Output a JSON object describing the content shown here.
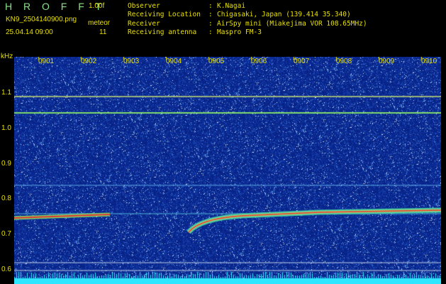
{
  "header": {
    "app_title": "H R O F F T",
    "version": "1.00f",
    "filename": "KN9_2504140900.png",
    "mode": "meteor",
    "datetime": "25.04.14 09:00",
    "count": "11"
  },
  "info": [
    {
      "key": "Observer",
      "value": "K.Nagai"
    },
    {
      "key": "Receiving Location",
      "value": "Chigasaki, Japan (139.414 35.340)"
    },
    {
      "key": "Receiver",
      "value": "AirSpy mini (Miakejima VOR 108.65MHz)"
    },
    {
      "key": "Receiving antenna",
      "value": "Maspro FM-3"
    }
  ],
  "colors": {
    "text": "#e8e000",
    "title": "#8be28b",
    "background_noise": "#0a2a8a",
    "trace": "#e33030",
    "carrier": "#2fd25a"
  },
  "spectrogram": {
    "y_unit": "kHz",
    "y_ticks": [
      "1.1",
      "1.0",
      "0.9",
      "0.8",
      "0.7",
      "0.6"
    ],
    "x_ticks": [
      "0901",
      "0902",
      "0903",
      "0904",
      "0905",
      "0906",
      "0907",
      "0908",
      "0909",
      "0910"
    ]
  }
}
